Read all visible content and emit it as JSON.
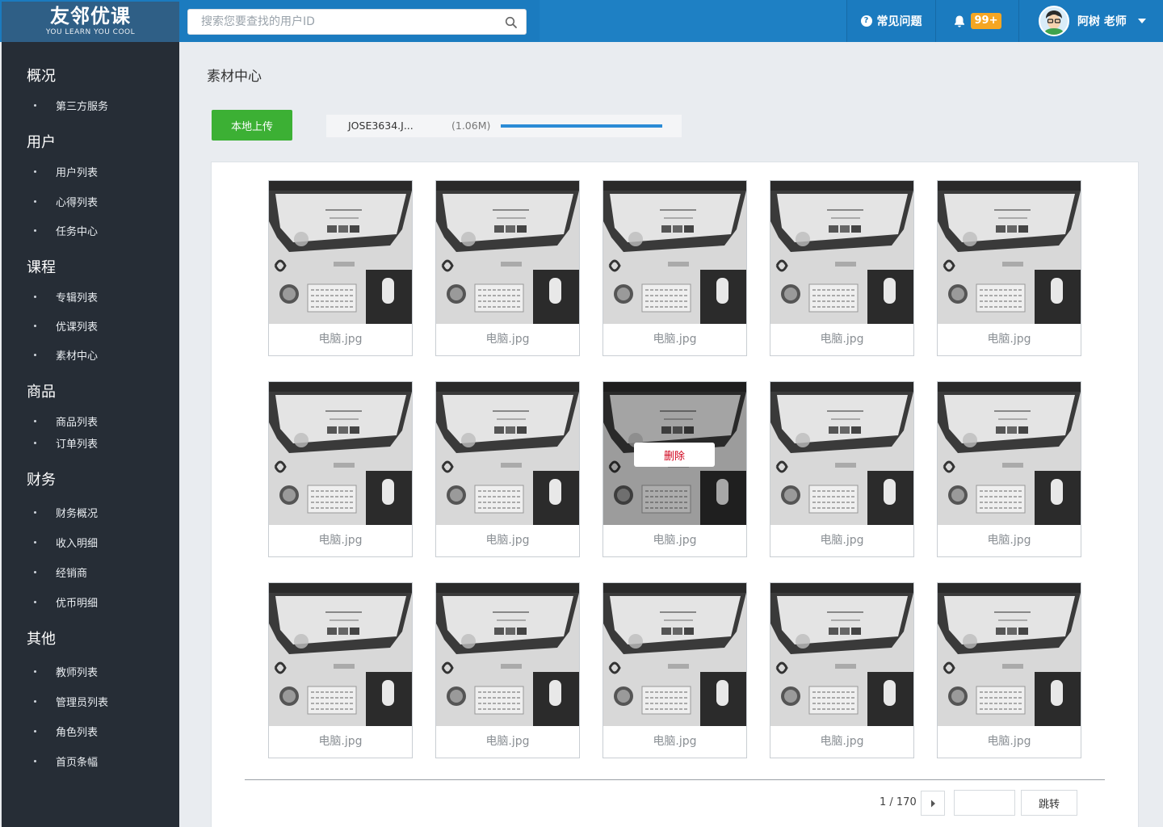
{
  "header": {
    "logo_title": "友邻优课",
    "logo_subtitle": "YOU LEARN YOU COOL",
    "search_placeholder": "搜索您要查找的用户ID",
    "faq_label": "常见问题",
    "notification_badge": "99+",
    "user_name": "阿树 老师"
  },
  "sidebar": {
    "sections": [
      {
        "title": "概况",
        "items": [
          "第三方服务"
        ]
      },
      {
        "title": "用户",
        "items": [
          "用户列表",
          "心得列表",
          "任务中心"
        ]
      },
      {
        "title": "课程",
        "items": [
          "专辑列表",
          "优课列表",
          "素材中心"
        ]
      },
      {
        "title": "商品",
        "items": [
          "商品列表",
          "订单列表"
        ]
      },
      {
        "title": "财务",
        "items": [
          "财务概况",
          "收入明细",
          "经销商",
          "优币明细"
        ]
      },
      {
        "title": "其他",
        "items": [
          "教师列表",
          "管理员列表",
          "角色列表",
          "首页条幅"
        ]
      }
    ]
  },
  "main": {
    "page_title": "素材中心",
    "upload_button": "本地上传",
    "upload": {
      "file_name": "JOSE3634.J...",
      "file_size": "(1.06M)",
      "progress": 1.0
    },
    "delete_label": "删除",
    "hovered_index": 7,
    "materials": [
      "电脑.jpg",
      "电脑.jpg",
      "电脑.jpg",
      "电脑.jpg",
      "电脑.jpg",
      "电脑.jpg",
      "电脑.jpg",
      "电脑.jpg",
      "电脑.jpg",
      "电脑.jpg",
      "电脑.jpg",
      "电脑.jpg",
      "电脑.jpg",
      "电脑.jpg",
      "电脑.jpg"
    ],
    "pagination": {
      "page_text": "1 / 170",
      "jump_label": "跳转"
    }
  }
}
